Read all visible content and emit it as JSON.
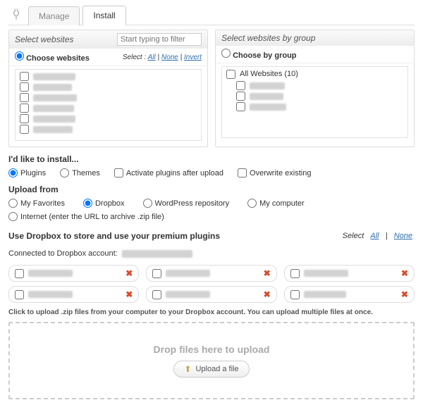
{
  "tabs": {
    "manage": "Manage",
    "install": "Install"
  },
  "left_panel": {
    "title": "Select websites",
    "filter_placeholder": "Start typing to filter",
    "choose_label": "Choose websites",
    "select_prefix": "Select :",
    "link_all": "All",
    "link_none": "None",
    "link_invert": "Invert"
  },
  "right_panel": {
    "title": "Select websites by group",
    "choose_label": "Choose by group",
    "all_label": "All Websites (10)"
  },
  "install": {
    "heading": "I'd like to install...",
    "opt_plugins": "Plugins",
    "opt_themes": "Themes",
    "chk_activate": "Activate plugins after upload",
    "chk_overwrite": "Overwrite existing"
  },
  "upload": {
    "heading": "Upload from",
    "fav": "My Favorites",
    "dropbox": "Dropbox",
    "wp": "WordPress repository",
    "computer": "My computer",
    "internet": "Internet (enter the URL to archive .zip file)"
  },
  "dropbox": {
    "heading": "Use Dropbox to store and use your premium plugins",
    "select_label": "Select",
    "all": "All",
    "none": "None",
    "connected_prefix": "Connected to Dropbox account:"
  },
  "dropzone": {
    "hint": "Click to upload .zip files from your computer to your Dropbox account. You can upload multiple files at once.",
    "drop_label": "Drop files here to upload",
    "button": "Upload a file"
  }
}
